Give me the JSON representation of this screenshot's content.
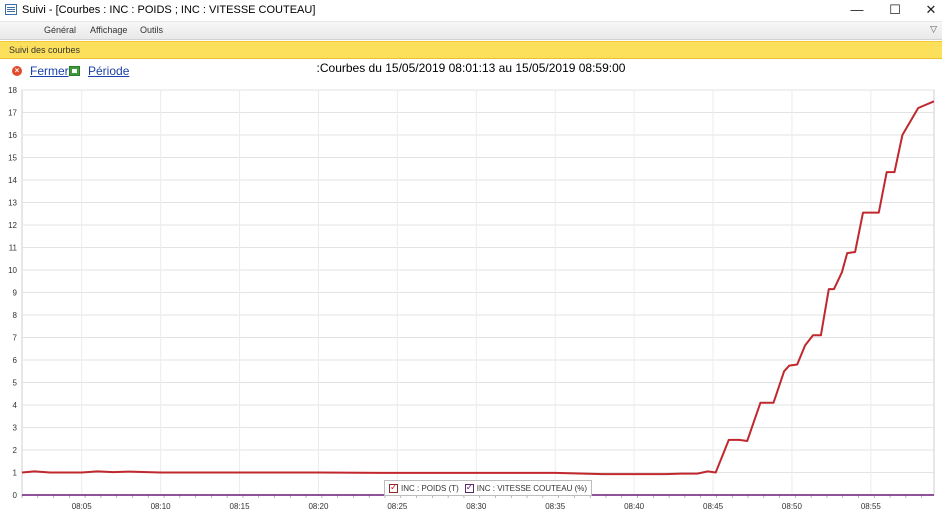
{
  "window": {
    "title": "Suivi - [Courbes : INC : POIDS ; INC : VITESSE COUTEAU]",
    "minimize": "—",
    "maximize": "☐",
    "close": "✕"
  },
  "menu": {
    "items": [
      "Général",
      "Affichage",
      "Outils"
    ]
  },
  "panel": {
    "label": "Suivi des courbes"
  },
  "toolbar": {
    "close_label": "Fermer",
    "period_label": "Période"
  },
  "chart_title": ":Courbes du 15/05/2019 08:01:13 au 15/05/2019 08:59:00",
  "legend": {
    "series1": "INC : POIDS (T)",
    "series2": "INC : VITESSE COUTEAU (%)"
  },
  "chart_data": {
    "type": "line",
    "title": ":Courbes du 15/05/2019 08:01:13 au 15/05/2019 08:59:00",
    "xlabel": "",
    "ylabel": "",
    "xlim": [
      "08:01:13",
      "08:59:00"
    ],
    "ylim": [
      0,
      18
    ],
    "y_ticks": [
      0,
      1,
      2,
      3,
      4,
      5,
      6,
      7,
      8,
      9,
      10,
      11,
      12,
      13,
      14,
      15,
      16,
      17,
      18
    ],
    "x_ticks": [
      "08:05",
      "08:10",
      "08:15",
      "08:20",
      "08:25",
      "08:30",
      "08:35",
      "08:40",
      "08:45",
      "08:50",
      "08:55"
    ],
    "grid": true,
    "legend_position": "bottom-center",
    "series": [
      {
        "name": "INC : POIDS (T)",
        "color": "#c0282d",
        "x": [
          "08:01:13",
          "08:02:00",
          "08:03:00",
          "08:04:00",
          "08:05:00",
          "08:06:00",
          "08:07:00",
          "08:08:00",
          "08:10:00",
          "08:12:00",
          "08:15:00",
          "08:20:00",
          "08:25:00",
          "08:30:00",
          "08:35:00",
          "08:38:00",
          "08:40:00",
          "08:42:00",
          "08:43:00",
          "08:44:00",
          "08:44:40",
          "08:45:10",
          "08:46:00",
          "08:46:40",
          "08:47:10",
          "08:48:00",
          "08:48:30",
          "08:48:50",
          "08:49:30",
          "08:49:50",
          "08:50:20",
          "08:50:50",
          "08:51:20",
          "08:51:50",
          "08:52:20",
          "08:52:40",
          "08:53:10",
          "08:53:30",
          "08:54:00",
          "08:54:30",
          "08:55:00",
          "08:55:30",
          "08:56:00",
          "08:56:30",
          "08:57:00",
          "08:58:00",
          "08:59:00"
        ],
        "values": [
          1.0,
          1.05,
          1.0,
          1.0,
          1.0,
          1.05,
          1.02,
          1.04,
          1.0,
          1.0,
          1.0,
          1.0,
          0.98,
          0.98,
          0.98,
          0.93,
          0.93,
          0.93,
          0.95,
          0.95,
          1.05,
          1.0,
          2.45,
          2.45,
          2.4,
          4.1,
          4.1,
          4.1,
          5.5,
          5.75,
          5.8,
          6.65,
          7.1,
          7.1,
          9.15,
          9.15,
          9.9,
          10.75,
          10.8,
          12.55,
          12.55,
          12.55,
          14.35,
          14.35,
          16.0,
          17.2,
          17.5
        ]
      },
      {
        "name": "INC : VITESSE COUTEAU (%)",
        "color": "#6a1a7a",
        "x": [
          "08:01:13",
          "08:59:00"
        ],
        "values": [
          0,
          0
        ]
      }
    ]
  }
}
